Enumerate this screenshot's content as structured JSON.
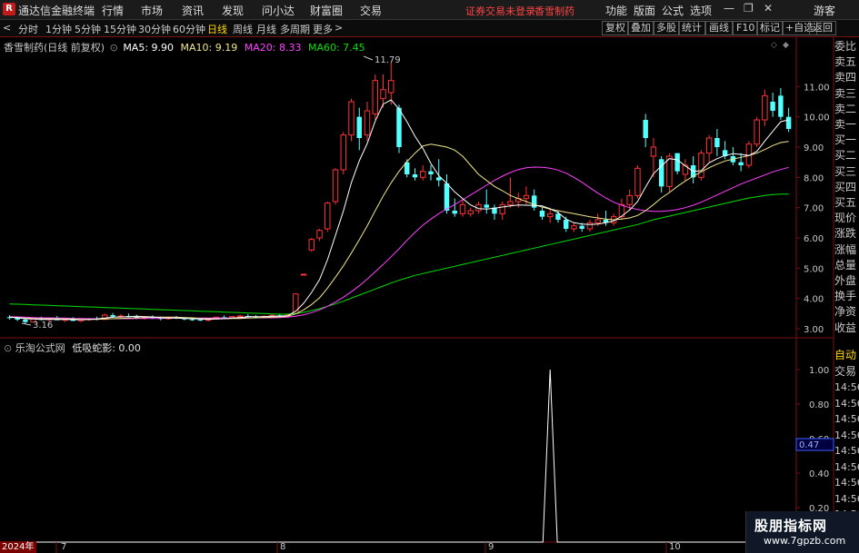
{
  "titlebar": {
    "app_name": "通达信金融终端",
    "menus": [
      "行情",
      "市场",
      "资讯",
      "发现",
      "问小达",
      "财富圈",
      "交易"
    ],
    "warning": "证券交易未登录",
    "stock": "香雪制药",
    "right_menus": [
      "功能",
      "版面",
      "公式",
      "选项"
    ],
    "guest": "游客"
  },
  "toolbar": {
    "periods": [
      "分时",
      "1分钟",
      "5分钟",
      "15分钟",
      "30分钟",
      "60分钟",
      "日线",
      "周线",
      "月线",
      "多周期",
      "更多"
    ],
    "active_period": "日线",
    "right_buttons": [
      "复权",
      "叠加",
      "多股",
      "统计",
      "画线",
      "F10",
      "标记",
      "+自选",
      "返回"
    ]
  },
  "main_chart": {
    "title": "香雪制药(日线 前复权)",
    "ma": [
      {
        "label": "MA5: 9.90",
        "color": "#ffffff"
      },
      {
        "label": "MA10: 9.19",
        "color": "#f0e68c"
      },
      {
        "label": "MA20: 8.33",
        "color": "#ff40ff"
      },
      {
        "label": "MA60: 7.45",
        "color": "#00e000"
      }
    ],
    "high_label": "11.79",
    "low_label": "3.16",
    "price_axis": [
      "11.00",
      "10.00",
      "9.00",
      "8.00",
      "7.00",
      "6.00",
      "5.00",
      "4.00",
      "3.00"
    ]
  },
  "sub_chart": {
    "title": "乐淘公式网",
    "indicator": "低吸蛇影: 0.00",
    "axis": [
      "1.00",
      "0.80",
      "0.60",
      "0.40",
      "0.20"
    ],
    "current_value": "0.47"
  },
  "side_panel": {
    "items": [
      "委比",
      "卖五",
      "卖四",
      "卖三",
      "卖二",
      "卖一",
      "买一",
      "买二",
      "买三",
      "买四",
      "买五",
      "现价",
      "涨跌",
      "涨幅",
      "总量",
      "外盘",
      "换手",
      "净资",
      "收益"
    ],
    "sub_items": [
      "自动",
      "交易",
      "14:56",
      "14:56",
      "14:56",
      "14:56",
      "14:56",
      "14:56",
      "14:56",
      "14:56",
      "14:56",
      "14:56",
      "14:56"
    ]
  },
  "x_axis": {
    "year_badge": "2024年",
    "months": [
      "7",
      "8",
      "9",
      "10"
    ]
  },
  "watermark": {
    "line1": "股朋指标网",
    "line2": "www.7gpzb.com"
  },
  "chart_data": {
    "type": "candlestick",
    "ylim": [
      2.7,
      12.3
    ],
    "candles": [
      [
        3.38,
        3.45,
        3.3,
        3.35
      ],
      [
        3.35,
        3.4,
        3.25,
        3.3
      ],
      [
        3.3,
        3.36,
        3.16,
        3.22
      ],
      [
        3.22,
        3.35,
        3.2,
        3.32
      ],
      [
        3.32,
        3.4,
        3.28,
        3.3
      ],
      [
        3.3,
        3.38,
        3.24,
        3.34
      ],
      [
        3.34,
        3.42,
        3.3,
        3.28
      ],
      [
        3.28,
        3.35,
        3.22,
        3.32
      ],
      [
        3.32,
        3.38,
        3.25,
        3.26
      ],
      [
        3.26,
        3.34,
        3.22,
        3.3
      ],
      [
        3.3,
        3.36,
        3.26,
        3.33
      ],
      [
        3.33,
        3.4,
        3.28,
        3.31
      ],
      [
        3.31,
        3.5,
        3.29,
        3.45
      ],
      [
        3.45,
        3.52,
        3.36,
        3.4
      ],
      [
        3.4,
        3.48,
        3.35,
        3.42
      ],
      [
        3.42,
        3.5,
        3.38,
        3.4
      ],
      [
        3.4,
        3.46,
        3.32,
        3.36
      ],
      [
        3.36,
        3.42,
        3.3,
        3.38
      ],
      [
        3.38,
        3.44,
        3.32,
        3.35
      ],
      [
        3.35,
        3.4,
        3.28,
        3.33
      ],
      [
        3.33,
        3.4,
        3.3,
        3.36
      ],
      [
        3.36,
        3.42,
        3.32,
        3.34
      ],
      [
        3.34,
        3.38,
        3.28,
        3.31
      ],
      [
        3.31,
        3.36,
        3.26,
        3.3
      ],
      [
        3.3,
        3.35,
        3.25,
        3.28
      ],
      [
        3.28,
        3.34,
        3.24,
        3.32
      ],
      [
        3.32,
        3.4,
        3.3,
        3.38
      ],
      [
        3.38,
        3.44,
        3.34,
        3.36
      ],
      [
        3.36,
        3.42,
        3.32,
        3.4
      ],
      [
        3.4,
        3.46,
        3.36,
        3.42
      ],
      [
        3.42,
        3.48,
        3.38,
        3.4
      ],
      [
        3.4,
        3.45,
        3.35,
        3.38
      ],
      [
        3.38,
        3.44,
        3.34,
        3.41
      ],
      [
        3.41,
        3.48,
        3.38,
        3.44
      ],
      [
        3.44,
        3.5,
        3.4,
        3.42
      ],
      [
        3.42,
        3.5,
        3.4,
        3.46
      ],
      [
        3.5,
        4.15,
        3.48,
        4.15
      ],
      [
        4.8,
        4.82,
        4.8,
        4.8
      ],
      [
        5.6,
        6.0,
        5.55,
        5.95
      ],
      [
        6.0,
        6.3,
        5.9,
        6.25
      ],
      [
        6.3,
        7.2,
        6.2,
        7.15
      ],
      [
        7.2,
        8.3,
        7.1,
        8.25
      ],
      [
        8.25,
        9.5,
        8.1,
        9.4
      ],
      [
        9.4,
        10.6,
        9.2,
        10.5
      ],
      [
        10.0,
        10.3,
        8.9,
        9.3
      ],
      [
        9.4,
        10.5,
        9.2,
        10.2
      ],
      [
        10.1,
        11.4,
        9.9,
        11.2
      ],
      [
        10.6,
        11.4,
        10.3,
        10.9
      ],
      [
        10.8,
        11.79,
        10.4,
        11.2
      ],
      [
        10.3,
        10.4,
        8.8,
        9.0
      ],
      [
        8.5,
        8.6,
        8.0,
        8.1
      ],
      [
        8.1,
        8.3,
        7.9,
        8.0
      ],
      [
        8.0,
        8.4,
        7.9,
        8.2
      ],
      [
        8.2,
        8.4,
        7.9,
        8.1
      ],
      [
        8.0,
        8.6,
        7.7,
        7.9
      ],
      [
        7.8,
        8.1,
        6.8,
        6.9
      ],
      [
        6.9,
        7.3,
        6.7,
        6.8
      ],
      [
        6.8,
        7.3,
        6.7,
        7.1
      ],
      [
        6.8,
        7.0,
        6.7,
        6.9
      ],
      [
        6.9,
        7.2,
        6.8,
        7.1
      ],
      [
        7.1,
        7.6,
        6.8,
        7.0
      ],
      [
        7.0,
        7.1,
        6.6,
        6.8
      ],
      [
        6.8,
        7.2,
        6.6,
        7.1
      ],
      [
        7.1,
        8.0,
        7.0,
        7.2
      ],
      [
        7.2,
        7.5,
        7.0,
        7.3
      ],
      [
        7.3,
        7.7,
        7.1,
        7.4
      ],
      [
        7.4,
        7.6,
        6.9,
        7.0
      ],
      [
        6.9,
        7.0,
        6.6,
        6.7
      ],
      [
        6.7,
        7.0,
        6.5,
        6.8
      ],
      [
        6.8,
        6.9,
        6.5,
        6.6
      ],
      [
        6.6,
        6.7,
        6.2,
        6.3
      ],
      [
        6.3,
        6.5,
        6.2,
        6.4
      ],
      [
        6.4,
        6.5,
        6.2,
        6.3
      ],
      [
        6.3,
        6.6,
        6.2,
        6.5
      ],
      [
        6.5,
        6.8,
        6.4,
        6.6
      ],
      [
        6.6,
        6.9,
        6.4,
        6.5
      ],
      [
        6.5,
        6.8,
        6.4,
        6.7
      ],
      [
        6.7,
        7.3,
        6.6,
        7.1
      ],
      [
        7.1,
        7.6,
        6.9,
        7.4
      ],
      [
        7.4,
        8.4,
        7.3,
        8.3
      ],
      [
        9.9,
        10.1,
        9.0,
        9.3
      ],
      [
        8.7,
        9.3,
        8.0,
        9.0
      ],
      [
        8.6,
        8.7,
        7.5,
        7.7
      ],
      [
        7.7,
        8.8,
        7.5,
        8.7
      ],
      [
        8.8,
        8.8,
        8.1,
        8.2
      ],
      [
        8.1,
        8.6,
        7.9,
        8.4
      ],
      [
        8.4,
        8.7,
        7.8,
        8.0
      ],
      [
        8.0,
        8.9,
        7.9,
        8.8
      ],
      [
        8.8,
        9.4,
        8.5,
        9.3
      ],
      [
        9.3,
        9.6,
        8.7,
        9.0
      ],
      [
        8.9,
        9.2,
        8.6,
        8.7
      ],
      [
        8.7,
        9.0,
        8.4,
        8.5
      ],
      [
        8.5,
        8.8,
        8.2,
        8.4
      ],
      [
        8.4,
        9.2,
        8.3,
        9.1
      ],
      [
        9.1,
        10.0,
        9.0,
        9.9
      ],
      [
        9.9,
        10.9,
        9.7,
        10.7
      ],
      [
        10.5,
        10.8,
        10.0,
        10.2
      ],
      [
        10.7,
        10.95,
        9.9,
        10.0
      ],
      [
        10.0,
        10.3,
        9.5,
        9.6
      ]
    ],
    "ma5": [
      3.38,
      3.36,
      3.33,
      3.32,
      3.31,
      3.31,
      3.31,
      3.31,
      3.3,
      3.3,
      3.31,
      3.32,
      3.35,
      3.38,
      3.39,
      3.4,
      3.41,
      3.4,
      3.39,
      3.36,
      3.35,
      3.35,
      3.34,
      3.33,
      3.32,
      3.31,
      3.32,
      3.33,
      3.35,
      3.37,
      3.4,
      3.4,
      3.4,
      3.41,
      3.42,
      3.43,
      3.58,
      3.84,
      4.2,
      4.62,
      5.28,
      6.08,
      6.89,
      7.82,
      8.55,
      9.12,
      9.86,
      10.42,
      10.56,
      10.26,
      9.84,
      9.36,
      8.96,
      8.46,
      8.06,
      7.8,
      7.52,
      7.3,
      7.09,
      6.97,
      6.95,
      6.98,
      7.02,
      7.06,
      7.09,
      7.08,
      7.07,
      7.06,
      6.96,
      6.84,
      6.62,
      6.5,
      6.46,
      6.44,
      6.46,
      6.5,
      6.56,
      6.72,
      6.92,
      7.2,
      7.68,
      8.12,
      8.38,
      8.62,
      8.58,
      8.38,
      8.2,
      8.22,
      8.48,
      8.62,
      8.72,
      8.78,
      8.76,
      8.72,
      8.86,
      9.2,
      9.52,
      9.84,
      9.9
    ],
    "ma10": [
      3.38,
      3.37,
      3.35,
      3.34,
      3.33,
      3.33,
      3.33,
      3.32,
      3.32,
      3.31,
      3.31,
      3.31,
      3.32,
      3.33,
      3.34,
      3.35,
      3.36,
      3.37,
      3.38,
      3.38,
      3.38,
      3.38,
      3.37,
      3.36,
      3.34,
      3.33,
      3.33,
      3.33,
      3.34,
      3.34,
      3.35,
      3.36,
      3.37,
      3.38,
      3.39,
      3.41,
      3.49,
      3.62,
      3.8,
      4.02,
      4.34,
      4.7,
      5.08,
      5.5,
      5.94,
      6.4,
      6.9,
      7.38,
      7.82,
      8.2,
      8.52,
      8.8,
      9.04,
      9.1,
      9.05,
      9.0,
      8.9,
      8.7,
      8.4,
      8.1,
      7.9,
      7.7,
      7.56,
      7.4,
      7.3,
      7.2,
      7.1,
      7.02,
      6.95,
      6.9,
      6.85,
      6.8,
      6.75,
      6.7,
      6.66,
      6.62,
      6.6,
      6.62,
      6.66,
      6.74,
      6.9,
      7.1,
      7.32,
      7.5,
      7.7,
      7.88,
      8.04,
      8.18,
      8.32,
      8.44,
      8.54,
      8.6,
      8.66,
      8.72,
      8.8,
      8.92,
      9.05,
      9.15,
      9.19
    ],
    "ma20": [
      3.4,
      3.39,
      3.38,
      3.37,
      3.36,
      3.36,
      3.35,
      3.35,
      3.34,
      3.34,
      3.33,
      3.33,
      3.33,
      3.33,
      3.33,
      3.33,
      3.34,
      3.34,
      3.34,
      3.34,
      3.35,
      3.35,
      3.35,
      3.35,
      3.35,
      3.35,
      3.35,
      3.35,
      3.35,
      3.35,
      3.36,
      3.36,
      3.36,
      3.36,
      3.37,
      3.38,
      3.41,
      3.46,
      3.53,
      3.62,
      3.74,
      3.88,
      4.04,
      4.22,
      4.42,
      4.64,
      4.88,
      5.12,
      5.38,
      5.64,
      5.92,
      6.18,
      6.42,
      6.62,
      6.8,
      6.96,
      7.1,
      7.26,
      7.42,
      7.58,
      7.74,
      7.9,
      8.04,
      8.16,
      8.26,
      8.32,
      8.34,
      8.33,
      8.3,
      8.24,
      8.14,
      8.0,
      7.84,
      7.66,
      7.48,
      7.32,
      7.18,
      7.08,
      7.0,
      6.94,
      6.9,
      6.88,
      6.88,
      6.9,
      6.94,
      7.0,
      7.08,
      7.18,
      7.3,
      7.42,
      7.54,
      7.66,
      7.78,
      7.88,
      7.98,
      8.08,
      8.18,
      8.26,
      8.33
    ],
    "ma60": [
      3.82,
      3.81,
      3.8,
      3.79,
      3.78,
      3.77,
      3.76,
      3.75,
      3.74,
      3.73,
      3.72,
      3.71,
      3.7,
      3.69,
      3.68,
      3.67,
      3.66,
      3.65,
      3.64,
      3.63,
      3.62,
      3.61,
      3.6,
      3.59,
      3.58,
      3.57,
      3.56,
      3.55,
      3.54,
      3.53,
      3.52,
      3.51,
      3.5,
      3.49,
      3.48,
      3.48,
      3.5,
      3.54,
      3.6,
      3.66,
      3.74,
      3.82,
      3.91,
      4.01,
      4.11,
      4.21,
      4.31,
      4.41,
      4.51,
      4.6,
      4.68,
      4.76,
      4.82,
      4.88,
      4.94,
      5.0,
      5.06,
      5.12,
      5.18,
      5.24,
      5.3,
      5.36,
      5.42,
      5.48,
      5.54,
      5.6,
      5.66,
      5.72,
      5.78,
      5.84,
      5.9,
      5.96,
      6.02,
      6.08,
      6.14,
      6.2,
      6.26,
      6.32,
      6.38,
      6.44,
      6.52,
      6.6,
      6.66,
      6.72,
      6.78,
      6.84,
      6.9,
      6.96,
      7.02,
      7.08,
      7.14,
      7.2,
      7.26,
      7.32,
      7.36,
      7.4,
      7.43,
      7.45,
      7.45
    ],
    "indicator": {
      "ylim": [
        0,
        1.1
      ],
      "spike_index": 68,
      "spike_value": 1.0
    }
  }
}
